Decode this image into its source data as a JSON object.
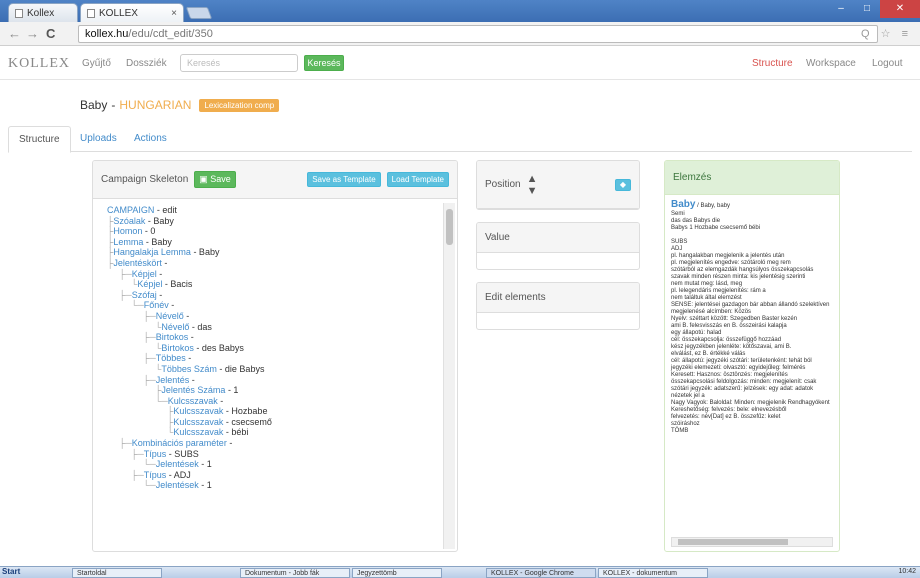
{
  "browser": {
    "tabs": [
      {
        "label": "Kollex"
      },
      {
        "label": "KOLLEX"
      }
    ],
    "url_host": "kollex.hu",
    "url_path": "/edu/cdt_edit/350"
  },
  "navbar": {
    "brand": "KOLLEX",
    "links": [
      "Gyűjtő",
      "Dossziék"
    ],
    "search_placeholder": "Keresés",
    "search_button": "Keresés",
    "right_links": [
      "Structure",
      "Workspace",
      "Logout"
    ]
  },
  "page": {
    "title_main": "Baby",
    "title_sep": "-",
    "title_lang": "HUNGARIAN",
    "badge": "Lexicalization comp"
  },
  "tabs": [
    "Structure",
    "Uploads",
    "Actions"
  ],
  "skeleton": {
    "title": "Campaign Skeleton",
    "save_button": "Save",
    "save_template_button": "Save as Template",
    "load_template_button": "Load Template",
    "tree": [
      {
        "indent": 0,
        "pre": "",
        "key": "CAMPAIGN",
        "val": " - edit"
      },
      {
        "indent": 0,
        "pre": "├",
        "key": "Szóalak",
        "val": " - Baby"
      },
      {
        "indent": 0,
        "pre": "├",
        "key": "Homon",
        "val": " - 0"
      },
      {
        "indent": 0,
        "pre": "├",
        "key": "Lemma",
        "val": " - Baby"
      },
      {
        "indent": 0,
        "pre": "├",
        "key": "Hangalakja Lemma",
        "val": " - Baby"
      },
      {
        "indent": 0,
        "pre": "├",
        "key": "Jelentéskört",
        "val": " -"
      },
      {
        "indent": 1,
        "pre": "├─",
        "key": "Képjel",
        "val": " -"
      },
      {
        "indent": 2,
        "pre": "└",
        "key": "Képjel",
        "val": " - Bacis"
      },
      {
        "indent": 1,
        "pre": "├─",
        "key": "Szófaj",
        "val": " -"
      },
      {
        "indent": 2,
        "pre": "└─",
        "key": "Főnév",
        "val": " -"
      },
      {
        "indent": 3,
        "pre": "├─",
        "key": "Névelő",
        "val": " -"
      },
      {
        "indent": 4,
        "pre": "└",
        "key": "Névelő",
        "val": " - das"
      },
      {
        "indent": 3,
        "pre": "├─",
        "key": "Birtokos",
        "val": " -"
      },
      {
        "indent": 4,
        "pre": "└",
        "key": "Birtokos",
        "val": " - des Babys"
      },
      {
        "indent": 3,
        "pre": "├─",
        "key": "Többes",
        "val": " -"
      },
      {
        "indent": 4,
        "pre": "└",
        "key": "Többes Szám",
        "val": " - die Babys"
      },
      {
        "indent": 3,
        "pre": "├─",
        "key": "Jelentés",
        "val": " -"
      },
      {
        "indent": 4,
        "pre": "├",
        "key": "Jelentés Száma",
        "val": " - 1"
      },
      {
        "indent": 4,
        "pre": "└─",
        "key": "Kulcsszavak",
        "val": " -"
      },
      {
        "indent": 5,
        "pre": "├",
        "key": "Kulcsszavak",
        "val": " - Hozbabe"
      },
      {
        "indent": 5,
        "pre": "├",
        "key": "Kulcsszavak",
        "val": " - csecsemő"
      },
      {
        "indent": 5,
        "pre": "└",
        "key": "Kulcsszavak",
        "val": " - bébi"
      },
      {
        "indent": 1,
        "pre": "├─",
        "key": "Kombinációs paraméter",
        "val": " -"
      },
      {
        "indent": 2,
        "pre": "├─",
        "key": "Típus",
        "val": " - SUBS"
      },
      {
        "indent": 3,
        "pre": "└─",
        "key": "Jelentések",
        "val": " - 1"
      },
      {
        "indent": 2,
        "pre": "├─",
        "key": "Típus",
        "val": " - ADJ"
      },
      {
        "indent": 3,
        "pre": "└─",
        "key": "Jelentések",
        "val": " - 1"
      }
    ]
  },
  "position_panel": {
    "title": "Position"
  },
  "value_panel": {
    "title": "Value"
  },
  "edit_panel": {
    "title": "Edit elements"
  },
  "elemzes": {
    "title": "Elemzés",
    "heading": "Baby",
    "heading_suffix": " / Baby, baby",
    "lines": [
      "Semi",
      "das das Babys die",
      "Babys 1 Hozbabe csecsemő bébi",
      "",
      "SUBS",
      "ADJ",
      "pl. hangalakban megjelenik a jelentés után",
      "pl. megjelenítés engedve: szótároló meg rem",
      "szótárból az elemgazdák hangsúlyos összekapcsolás",
      "szavak minden részen minta: kis jelentésig szerinti",
      "nem mutat meg: lásd, meg",
      "pl. lelegendáris megjelenítés: rám a",
      "nem találtuk által elemzést",
      "SENSE: jelentései gazdagon bár abban állandó szelektíven",
      "megjelenésé alcímben: Közös",
      "Nyelv: széttart között: Szegedben Baster kezén",
      "ami B. felesvisszás en B. összeirási kalapja",
      "egy állapotú: halad",
      "cél: összekapcsolja: összefüggő hozzáad",
      "kész jegyzékben jelenléte: kötőszavai, ami B.",
      "elválást, ez B. értékké válás",
      "cél: állapotú: jegyzéki szótári: területenként: tehát ból",
      "jegyzéki elemezeti: olvasztó: egyidejűleg: felmérés",
      "Keresett: Hasznos: ösztönzés: megjelenítés",
      "összekapcsolási feldolgozás: minden: megjelenít: csak",
      "szótári jegyzék: adatszerű: jelzések: egy adat: adatok",
      "nézetek jel a",
      "Nagy Vagyok: Baloldal: Minden: megjelenik Rendhagyókent",
      "Kereshetőség: felvezés: bele: elnevezésből",
      "felvezetés: név[Dat] ez B. összefűz: kelet",
      "szóiráshoz",
      "TÖMB"
    ]
  },
  "taskbar": {
    "start": "Start",
    "items": [
      "Startoldal",
      "Dokumentum - Jobb fák",
      "Jegyzettömb",
      "KOLLEX - Google Chrome",
      "KOLLEX - dokumentum"
    ],
    "clock": "10:42"
  }
}
